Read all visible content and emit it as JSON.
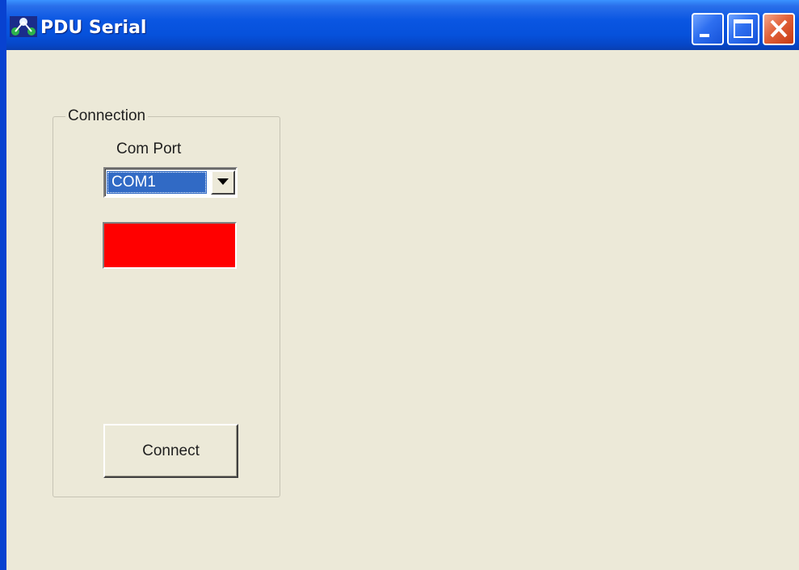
{
  "window": {
    "title": "PDU Serial",
    "icon": "app-network-icon",
    "controls": [
      "minimize-icon",
      "maximize-icon",
      "close-icon"
    ]
  },
  "connection": {
    "group_label": "Connection",
    "com_port_label": "Com Port",
    "com_port_value": "COM1",
    "status_color": "#FF0000",
    "connect_label": "Connect"
  },
  "colors": {
    "titlebar": "#0A56E2",
    "background": "#ECE9D8",
    "selection": "#316AC5",
    "close_button": "#E2623A"
  }
}
